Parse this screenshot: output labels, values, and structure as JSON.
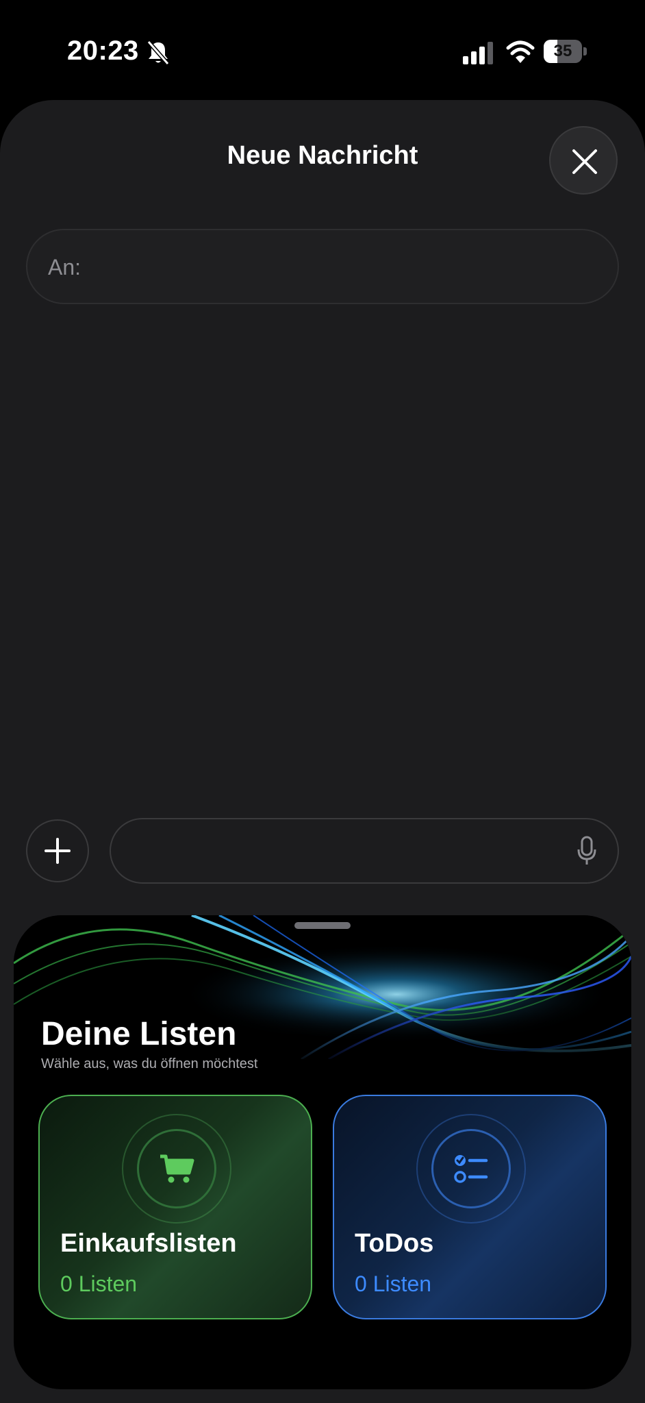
{
  "status_bar": {
    "time": "20:23",
    "battery_percent": "35",
    "battery_level": 0.35,
    "icons": [
      "bell-slash-icon",
      "signal-icon",
      "wifi-icon",
      "battery-icon"
    ]
  },
  "compose": {
    "title": "Neue Nachricht",
    "close_icon": "xmark-icon",
    "to_label": "An:",
    "message_placeholder": "",
    "plus_icon": "plus-icon",
    "mic_icon": "mic-icon"
  },
  "lists_panel": {
    "title": "Deine Listen",
    "subtitle": "Wähle aus, was du öffnen möchtest",
    "cards": [
      {
        "title": "Einkaufslisten",
        "count": "0 Listen",
        "icon": "cart-icon",
        "accent": "#4caf50"
      },
      {
        "title": "ToDos",
        "count": "0 Listen",
        "icon": "checklist-icon",
        "accent": "#3a7be0"
      }
    ]
  },
  "colors": {
    "background": "#000000",
    "sheet": "#1c1c1e",
    "green_accent": "#5ecb5e",
    "blue_accent": "#3d8bff"
  }
}
